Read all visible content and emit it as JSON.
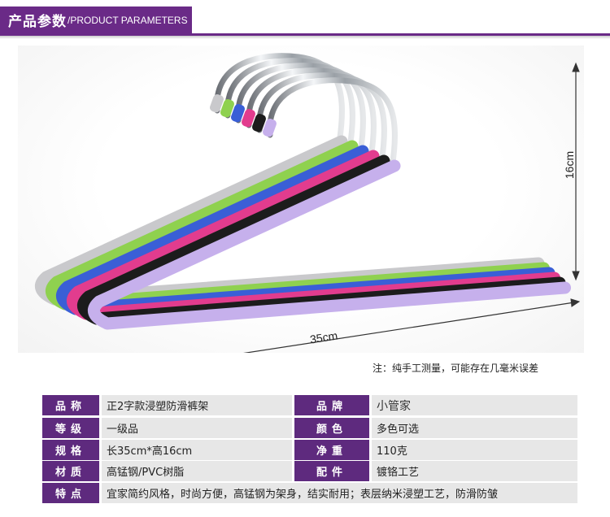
{
  "header": {
    "title_cn": "产品参数",
    "title_en": "/PRODUCT PARAMETERS"
  },
  "photo": {
    "height_label": "16cm",
    "width_label": "35cm",
    "hanger_colors": [
      "#c9c9cc",
      "#8fd14f",
      "#3a5fd6",
      "#e23c8e",
      "#1c1c1c",
      "#c6b0ec"
    ]
  },
  "note": "注：纯手工测量，可能存在几毫米误差",
  "params": {
    "rows": [
      {
        "l1": "品称",
        "v1": "正2字款浸塑防滑裤架",
        "l2": "品牌",
        "v2": "小管家"
      },
      {
        "l1": "等级",
        "v1": "一级品",
        "l2": "颜色",
        "v2": "多色可选"
      },
      {
        "l1": "规格",
        "v1": "长35cm*高16cm",
        "l2": "净重",
        "v2": "110克"
      },
      {
        "l1": "材质",
        "v1": "高锰钢/PVC树脂",
        "l2": "配件",
        "v2": "镀铬工艺"
      }
    ],
    "feature_label": "特点",
    "feature_value": "宜家简约风格，时尚方便，高锰钢为架身，结实耐用；表层纳米浸塑工艺，防滑防皱"
  },
  "colors": {
    "accent": "#6a2a87",
    "label_bg": "#5e2a7e",
    "value_bg": "#e7e7e7"
  }
}
